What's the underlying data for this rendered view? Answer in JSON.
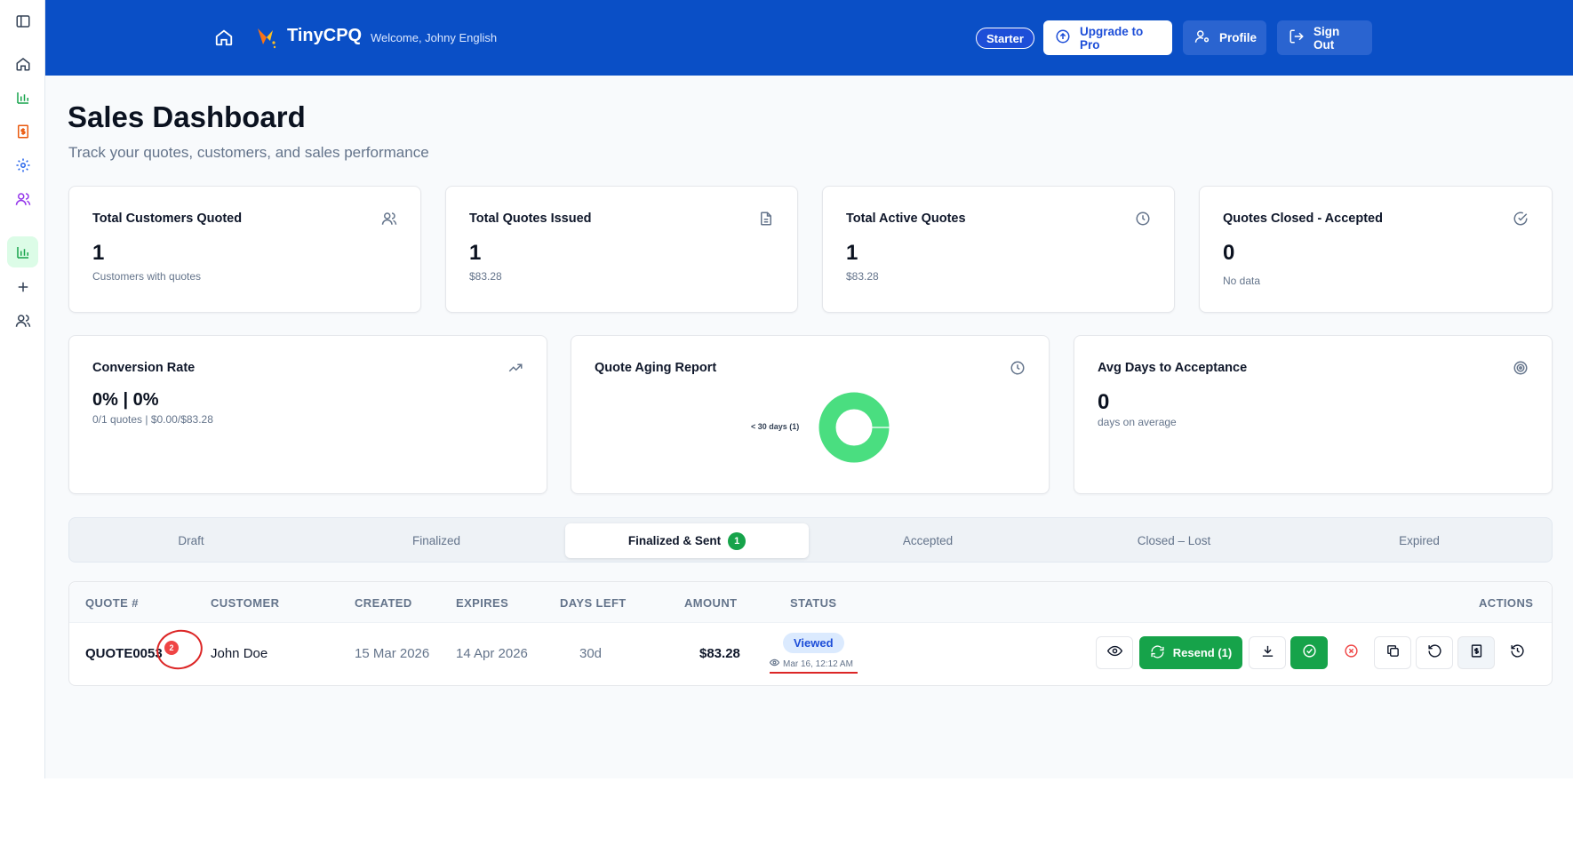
{
  "header": {
    "brand": "TinyCPQ",
    "welcome": "Welcome, Johny English",
    "plan": "Starter",
    "upgrade_label": "Upgrade to Pro",
    "profile_label": "Profile",
    "signout_label": "Sign Out"
  },
  "page": {
    "title": "Sales Dashboard",
    "subtitle": "Track your quotes, customers, and sales performance"
  },
  "stats": [
    {
      "title": "Total Customers Quoted",
      "value": "1",
      "sub": "Customers with quotes",
      "icon": "users-icon"
    },
    {
      "title": "Total Quotes Issued",
      "value": "1",
      "sub": "$83.28",
      "icon": "document-icon"
    },
    {
      "title": "Total Active Quotes",
      "value": "1",
      "sub": "$83.28",
      "icon": "clock-icon"
    },
    {
      "title": "Quotes Closed - Accepted",
      "value": "0",
      "sub": "No data",
      "icon": "check-circle-icon"
    }
  ],
  "conversion": {
    "title": "Conversion Rate",
    "value": "0% | 0%",
    "sub": "0/1 quotes | $0.00/$83.28",
    "icon": "trending-up-icon"
  },
  "aging": {
    "title": "Quote Aging Report",
    "icon": "clock-icon",
    "chart_data": {
      "type": "pie",
      "categories": [
        "< 30 days (1)"
      ],
      "values": [
        1
      ],
      "title": "",
      "colors": [
        "#4ade80"
      ]
    }
  },
  "avg_days": {
    "title": "Avg Days to Acceptance",
    "value": "0",
    "sub": "days on average",
    "icon": "target-icon"
  },
  "tabs": [
    {
      "label": "Draft"
    },
    {
      "label": "Finalized"
    },
    {
      "label": "Finalized & Sent",
      "count": "1",
      "active": true
    },
    {
      "label": "Accepted"
    },
    {
      "label": "Closed – Lost"
    },
    {
      "label": "Expired"
    }
  ],
  "table": {
    "headers": [
      "QUOTE #",
      "CUSTOMER",
      "CREATED",
      "EXPIRES",
      "DAYS LEFT",
      "AMOUNT",
      "STATUS",
      "ACTIONS"
    ],
    "row": {
      "quote": "QUOTE0053",
      "badge": "2",
      "customer": "John Doe",
      "created": "15 Mar 2026",
      "expires": "14 Apr 2026",
      "days_left": "30d",
      "amount": "$83.28",
      "status": "Viewed",
      "status_time": "Mar 16, 12:12 AM",
      "resend_label": "Resend (1)"
    }
  },
  "colors": {
    "header_bg": "#0a4fc6",
    "accent_green": "#16a34a",
    "donut_green": "#4ade80",
    "status_blue": "#dbeafe",
    "annotation_red": "#dc2626"
  }
}
